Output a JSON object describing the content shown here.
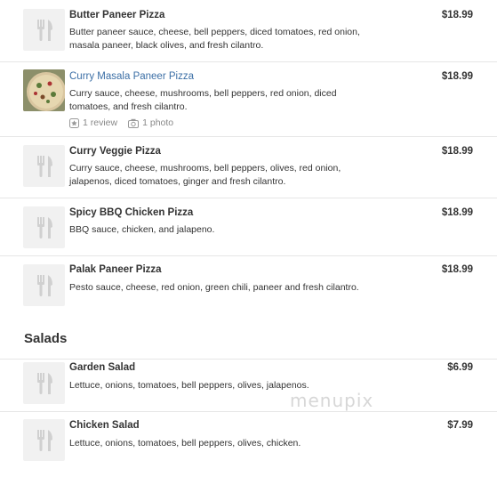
{
  "items": [
    {
      "name": "Butter Paneer Pizza",
      "price": "$18.99",
      "desc": "Butter paneer sauce, cheese, bell peppers, diced tomatoes, red onion, masala paneer, black olives, and fresh cilantro.",
      "icon": "utensils-icon"
    },
    {
      "name": "Curry Masala Paneer Pizza",
      "price": "$18.99",
      "desc": "Curry sauce, cheese, mushrooms, bell peppers, red onion, diced tomatoes, and fresh cilantro.",
      "reviews": "1 review",
      "photos": "1 photo",
      "icon": "pizza-photo"
    },
    {
      "name": "Curry Veggie Pizza",
      "price": "$18.99",
      "desc": "Curry sauce, cheese, mushrooms, bell peppers, olives, red onion, jalapenos, diced tomatoes, ginger and fresh cilantro.",
      "icon": "utensils-icon"
    },
    {
      "name": "Spicy BBQ Chicken Pizza",
      "price": "$18.99",
      "desc": "BBQ sauce, chicken, and jalapeno.",
      "icon": "utensils-icon"
    },
    {
      "name": "Palak Paneer Pizza",
      "price": "$18.99",
      "desc": "Pesto sauce, cheese, red onion, green chili, paneer and fresh cilantro.",
      "icon": "utensils-icon"
    }
  ],
  "salads": {
    "title": "Salads",
    "items": [
      {
        "name": "Garden Salad",
        "price": "$6.99",
        "desc": "Lettuce, onions, tomatoes, bell peppers, olives, jalapenos.",
        "icon": "utensils-icon"
      },
      {
        "name": "Chicken Salad",
        "price": "$7.99",
        "desc": "Lettuce, onions, tomatoes, bell peppers, olives, chicken.",
        "icon": "utensils-icon"
      }
    ]
  },
  "watermark": "menupix",
  "colors": {
    "link": "#3c6fa6",
    "text": "#333333",
    "muted": "#888888",
    "divider": "#e6e6e6"
  }
}
